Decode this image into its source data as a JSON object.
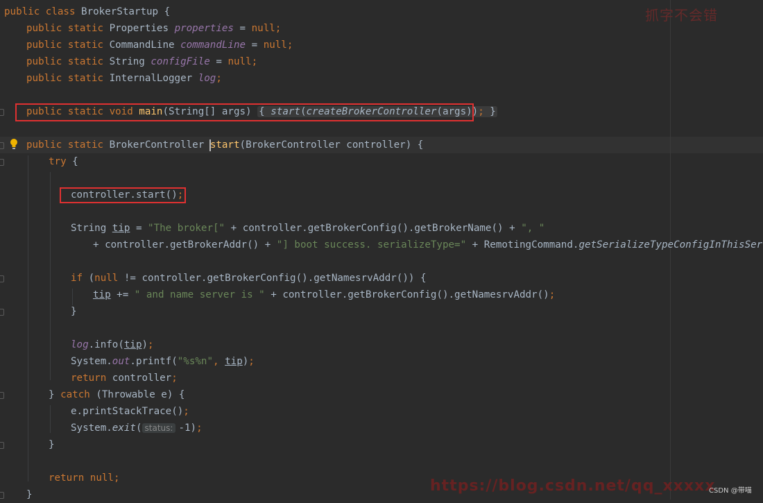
{
  "editor": {
    "theme_colors": {
      "background": "#2b2b2b",
      "keyword": "#cc7832",
      "string": "#6a8759",
      "field": "#9876aa",
      "method_declaration": "#ffc66d",
      "default_text": "#a9b7c6",
      "highlight_box": "#e03131"
    },
    "lines": {
      "l1": {
        "a": "public class ",
        "b": "BrokerStartup {"
      },
      "l2": {
        "a": "public static ",
        "b": "Properties ",
        "c": "properties",
        "d": " = ",
        "e": "null",
        "f": ";"
      },
      "l3": {
        "a": "public static ",
        "b": "CommandLine ",
        "c": "commandLine",
        "d": " = ",
        "e": "null",
        "f": ";"
      },
      "l4": {
        "a": "public static ",
        "b": "String ",
        "c": "configFile",
        "d": " = ",
        "e": "null",
        "f": ";"
      },
      "l5": {
        "a": "public static ",
        "b": "InternalLogger ",
        "c": "log",
        "f": ";"
      },
      "l7": {
        "a": "public static void ",
        "b": "main",
        "c": "(String[] args) ",
        "d": "{ ",
        "e": "start",
        "f": "(",
        "g": "createBrokerController",
        "h": "(args))",
        "i": ";",
        "j": " }"
      },
      "l9": {
        "a": "public static ",
        "b": "BrokerController ",
        "c": "start",
        "d": "(BrokerController controller) {"
      },
      "l10": {
        "a": "try ",
        "b": "{"
      },
      "l12": {
        "a": "controller.start()",
        "b": ";"
      },
      "l14": {
        "a": "String ",
        "b": "tip",
        "c": " = ",
        "d": "\"The broker[\"",
        "e": " + controller.getBrokerConfig().getBrokerName() + ",
        "f": "\", \""
      },
      "l15": {
        "a": "+ controller.getBrokerAddr() + ",
        "b": "\"] boot success. serializeType=\"",
        "c": " + RemotingCommand.",
        "d": "getSerializeTypeConfigInThisServer",
        "e": "()",
        "f": ";"
      },
      "l17": {
        "a": "if ",
        "b": "(",
        "c": "null",
        "d": " != controller.getBrokerConfig().getNamesrvAddr()) {"
      },
      "l18": {
        "a": "tip",
        "b": " += ",
        "c": "\" and name server is \"",
        "d": " + controller.getBrokerConfig().getNamesrvAddr()",
        "e": ";"
      },
      "l19": {
        "a": "}"
      },
      "l21": {
        "a": "log",
        "b": ".info(",
        "c": "tip",
        "d": ")",
        "e": ";"
      },
      "l22": {
        "a": "System.",
        "b": "out",
        "c": ".printf(",
        "d": "\"%s%n\"",
        "e": ", ",
        "f": "tip",
        "g": ")",
        "h": ";"
      },
      "l23": {
        "a": "return ",
        "b": "controller",
        "c": ";"
      },
      "l24": {
        "a": "} ",
        "b": "catch ",
        "c": "(Throwable e) {"
      },
      "l25": {
        "a": "e.printStackTrace()",
        "b": ";"
      },
      "l26": {
        "a": "System.",
        "b": "exit",
        "c": "(",
        "d": "status:",
        "e": "-1)",
        "f": ";"
      },
      "l27": {
        "a": "}"
      },
      "l29": {
        "a": "return ",
        "b": "null",
        "c": ";"
      },
      "l30": {
        "a": "}"
      }
    }
  },
  "watermarks": {
    "top_right": "抓字不会错",
    "bottom": "https://blog.csdn.net/qq_xxxxx",
    "csdn": "CSDN @带喵"
  }
}
